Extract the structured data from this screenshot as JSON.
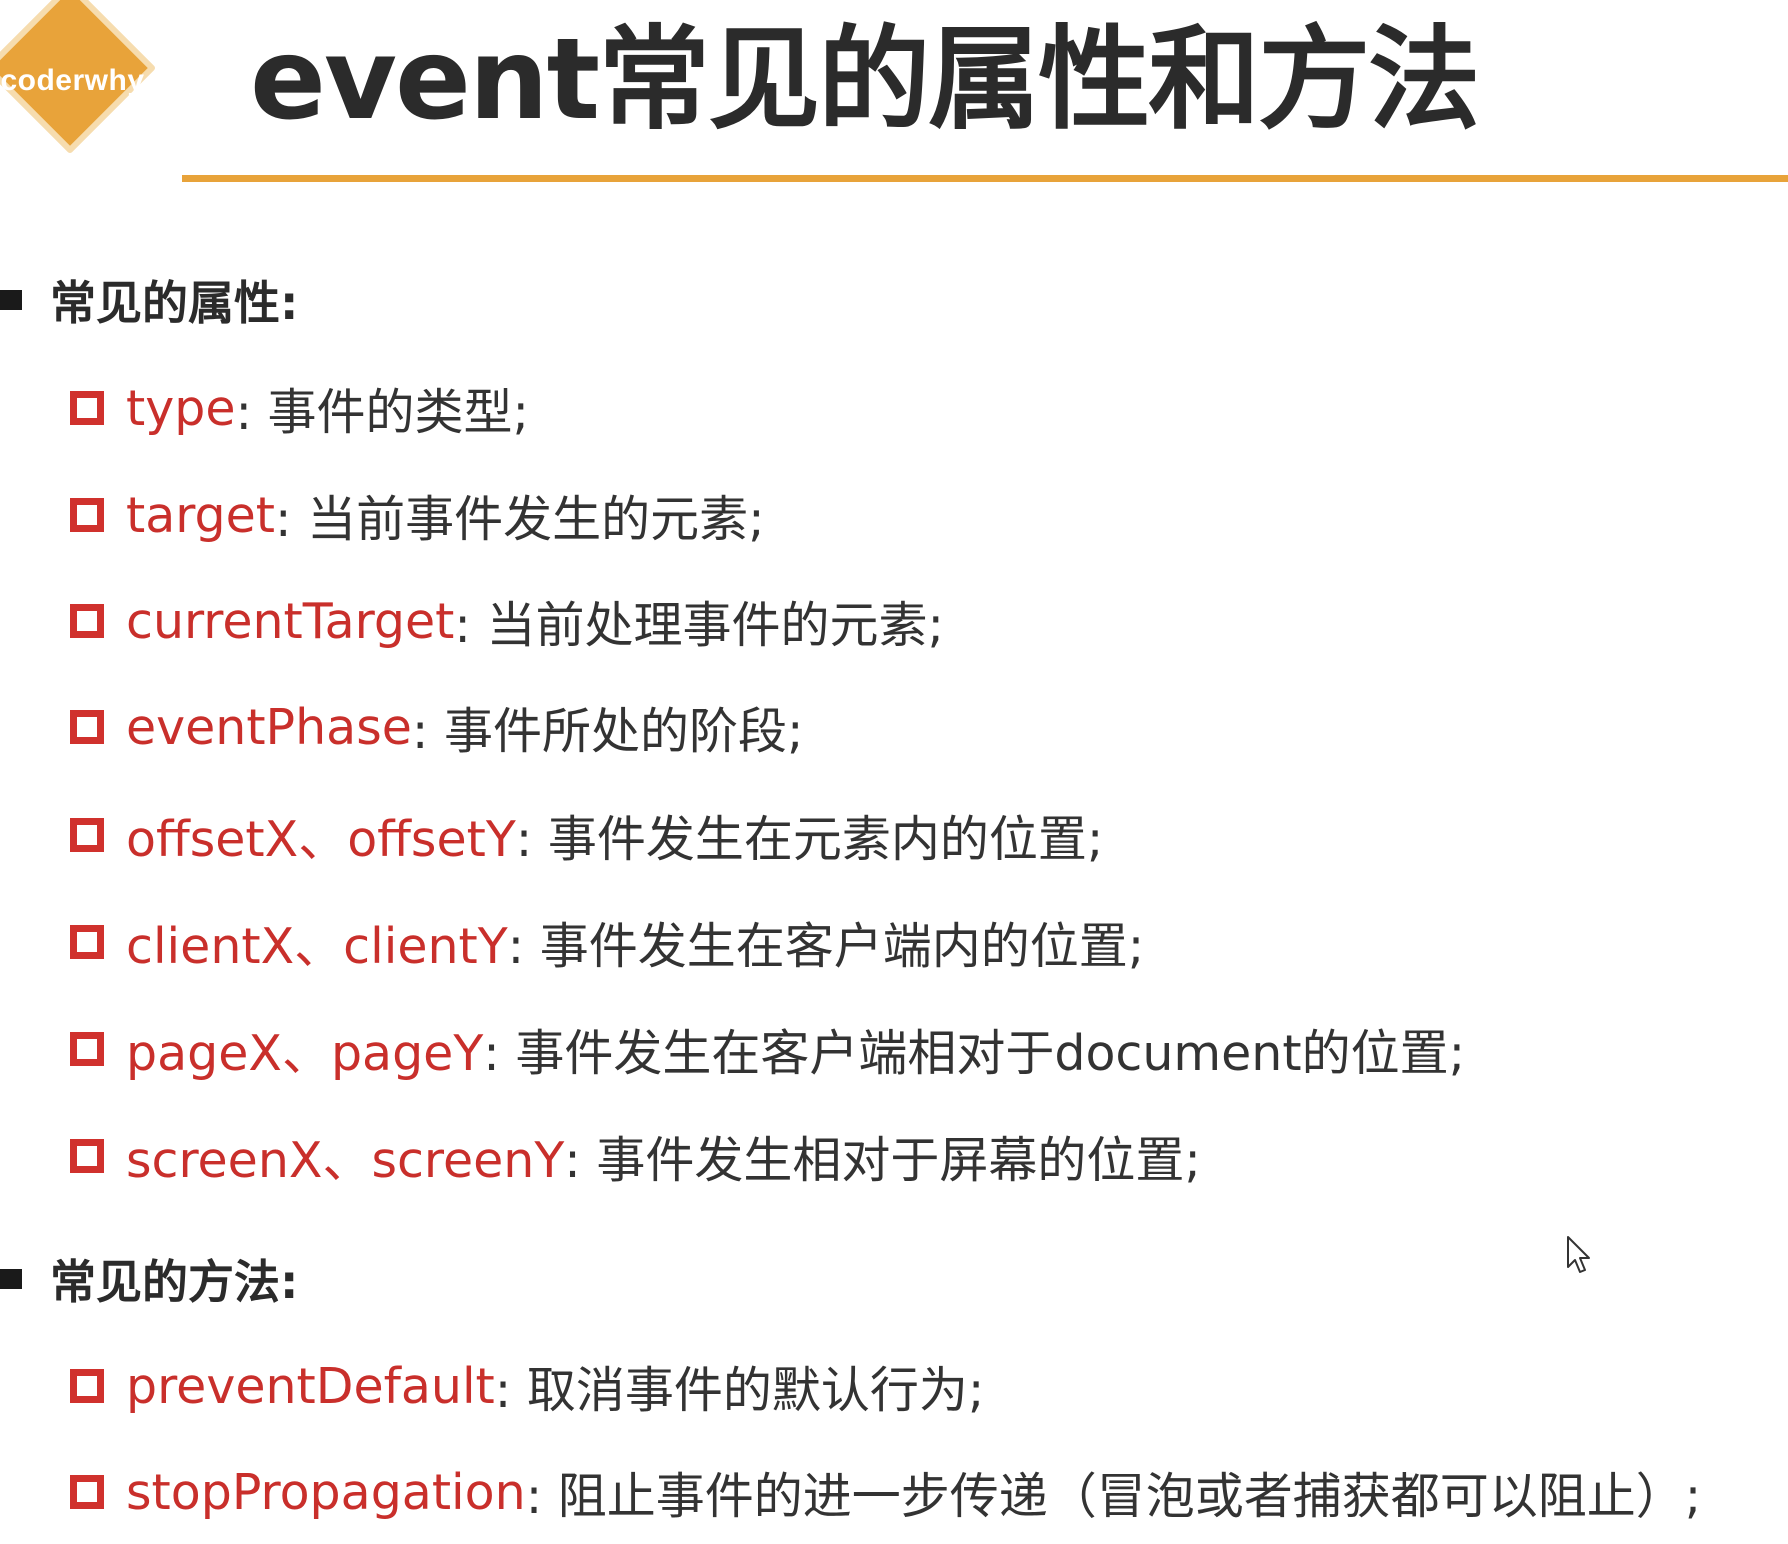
{
  "header": {
    "logo_text": "coderwhy",
    "title": "event常见的属性和方法",
    "accent_color": "#e8a33a",
    "logo_color": "#e8a33a"
  },
  "properties_section": {
    "heading": "常见的属性:",
    "items": [
      {
        "name": "type",
        "desc": ": 事件的类型;"
      },
      {
        "name": "target",
        "desc": ": 当前事件发生的元素;"
      },
      {
        "name": "currentTarget",
        "desc": ": 当前处理事件的元素;"
      },
      {
        "name": "eventPhase",
        "desc": ": 事件所处的阶段;"
      },
      {
        "name": "offsetX、offsetY",
        "desc": ": 事件发生在元素内的位置;"
      },
      {
        "name": "clientX、clientY",
        "desc": ": 事件发生在客户端内的位置;"
      },
      {
        "name": "pageX、pageY",
        "desc": ": 事件发生在客户端相对于document的位置;"
      },
      {
        "name": "screenX、screenY",
        "desc": ": 事件发生相对于屏幕的位置;"
      }
    ]
  },
  "methods_section": {
    "heading": "常见的方法:",
    "items": [
      {
        "name": "preventDefault",
        "desc": ": 取消事件的默认行为;"
      },
      {
        "name": "stopPropagation",
        "desc": ": 阻止事件的进一步传递（冒泡或者捕获都可以阻止）;"
      }
    ]
  },
  "colors": {
    "item_name": "#c92f2b",
    "item_bullet": "#d0312d",
    "text": "#333333"
  },
  "icons": {
    "cursor": "mouse-pointer-icon",
    "logo": "diamond-logo-icon"
  }
}
